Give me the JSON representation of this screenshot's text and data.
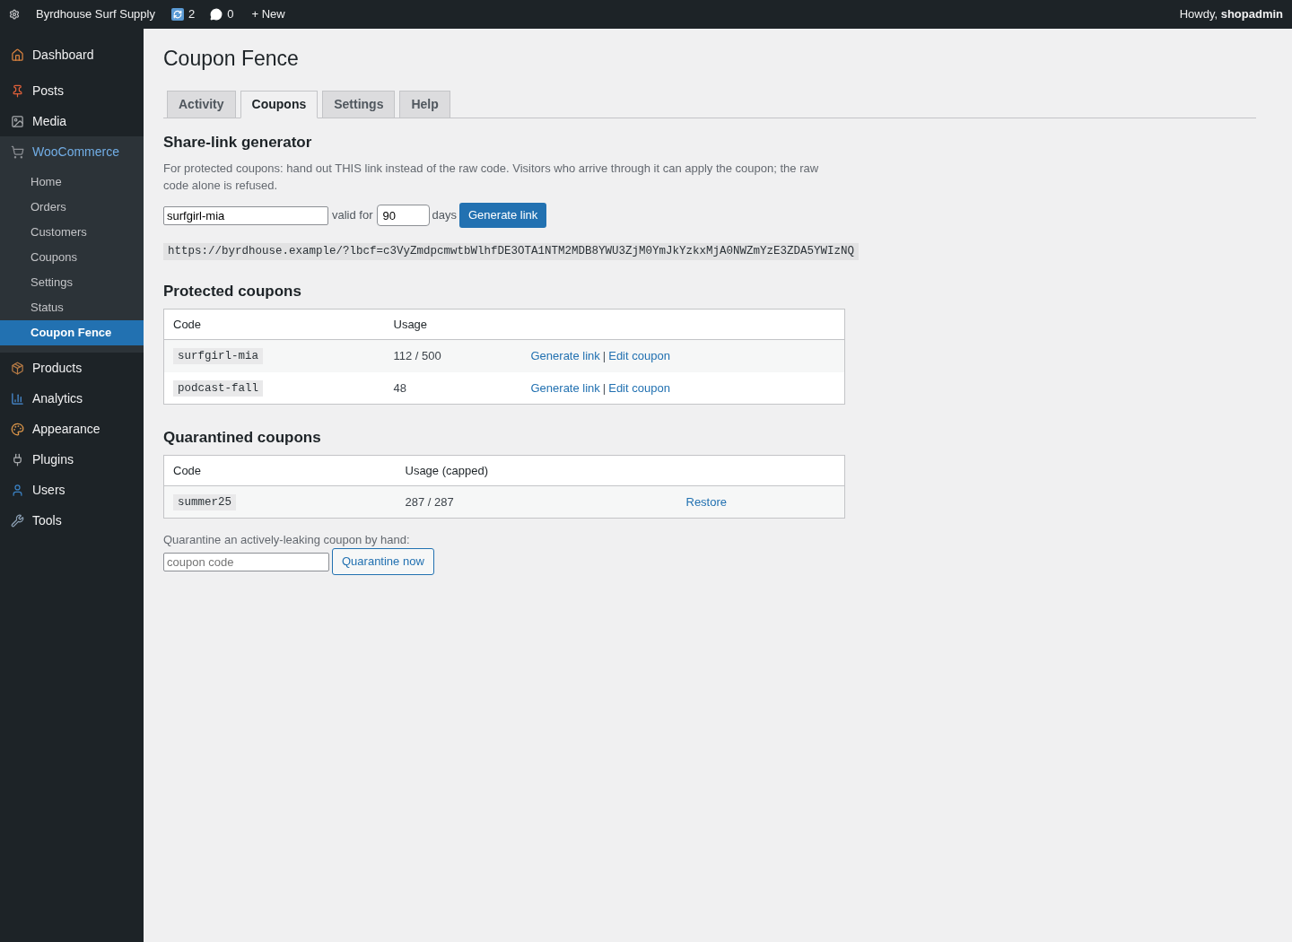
{
  "admin_bar": {
    "site_name": "Byrdhouse Surf Supply",
    "updates_count": "2",
    "comments_count": "0",
    "new_label": "+ New",
    "greeting": "Howdy, **shopadmin**"
  },
  "sidebar": {
    "items": [
      {
        "label": "Dashboard",
        "selected": false,
        "expanded": false
      },
      {
        "label": "Posts",
        "selected": false,
        "expanded": false
      },
      {
        "label": "Media",
        "selected": false,
        "expanded": false
      },
      {
        "label": "WooCommerce",
        "selected": false,
        "expanded": true,
        "children": [
          {
            "label": "Home",
            "selected": false
          },
          {
            "label": "Orders",
            "selected": false
          },
          {
            "label": "Customers",
            "selected": false
          },
          {
            "label": "Coupons",
            "selected": false
          },
          {
            "label": "Settings",
            "selected": false
          },
          {
            "label": "Status",
            "selected": false
          },
          {
            "label": "Coupon Fence",
            "selected": true
          }
        ]
      },
      {
        "label": "Products",
        "selected": false,
        "expanded": false
      },
      {
        "label": "Analytics",
        "selected": false,
        "expanded": false
      },
      {
        "label": "Appearance",
        "selected": false,
        "expanded": false
      },
      {
        "label": "Plugins",
        "selected": false,
        "expanded": false
      },
      {
        "label": "Users",
        "selected": false,
        "expanded": false
      },
      {
        "label": "Tools",
        "selected": false,
        "expanded": false
      }
    ]
  },
  "page": {
    "title": "Coupon Fence"
  },
  "tabs": [
    {
      "label": "Activity",
      "selected": false
    },
    {
      "label": "Coupons",
      "selected": true
    },
    {
      "label": "Settings",
      "selected": false
    },
    {
      "label": "Help",
      "selected": false
    }
  ],
  "share_link": {
    "heading": "Share-link generator",
    "description": "For protected coupons: hand out THIS link instead of the raw code. Visitors who arrive through it can apply the coupon; the raw code alone is refused.",
    "code_field": {
      "value": "surfgirl-mia"
    },
    "valid_for_label": "valid for",
    "days_field": {
      "value": "90"
    },
    "days_label": "days",
    "button": "Generate link",
    "generated_url": "https://byrdhouse.example/?lbcf=c3VyZmdpcmwtbWlhfDE3OTA1NTM2MDB8YWU3ZjM0YmJkYzkxMjA0NWZmYzE3ZDA5YWIzNQ"
  },
  "protected_coupons": {
    "heading": "Protected coupons",
    "columns": [
      "Code",
      "Usage"
    ],
    "rows": [
      {
        "code": "surfgirl-mia",
        "usage": "112 / 500",
        "actions": [
          "Generate link",
          "Edit coupon"
        ],
        "separator": "|"
      },
      {
        "code": "podcast-fall",
        "usage": "48",
        "actions": [
          "Generate link",
          "Edit coupon"
        ],
        "separator": "|"
      }
    ]
  },
  "quarantined_coupons": {
    "heading": "Quarantined coupons",
    "columns": [
      "Code",
      "Usage (capped)"
    ],
    "rows": [
      {
        "code": "summer25",
        "usage": "287 / 287",
        "actions": [
          "Restore"
        ]
      }
    ]
  },
  "manual_quarantine": {
    "label": "Quarantine an actively-leaking coupon by hand:",
    "field": {
      "placeholder": "coupon code"
    },
    "button": "Quarantine now"
  }
}
